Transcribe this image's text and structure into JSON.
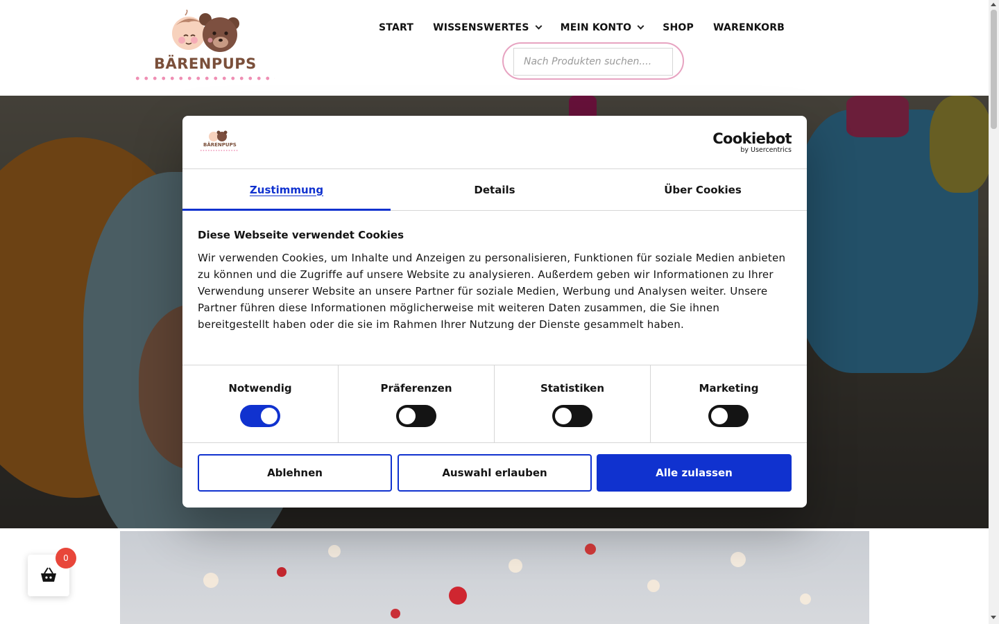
{
  "header": {
    "logo_text": "BÄRENPUPS",
    "nav": [
      {
        "label": "START",
        "has_dropdown": false
      },
      {
        "label": "WISSENSWERTES",
        "has_dropdown": true
      },
      {
        "label": "MEIN KONTO",
        "has_dropdown": true
      },
      {
        "label": "SHOP",
        "has_dropdown": false
      },
      {
        "label": "WARENKORB",
        "has_dropdown": false
      }
    ],
    "search": {
      "placeholder": "Nach Produkten suchen....",
      "value": ""
    }
  },
  "cookie_dialog": {
    "brand": {
      "name": "Cookiebot",
      "sub": "by Usercentrics"
    },
    "logo_text": "BÄRENPUPS",
    "tabs": [
      {
        "label": "Zustimmung",
        "active": true
      },
      {
        "label": "Details",
        "active": false
      },
      {
        "label": "Über Cookies",
        "active": false
      }
    ],
    "title": "Diese Webseite verwendet Cookies",
    "text": "Wir verwenden Cookies, um Inhalte und Anzeigen zu personalisieren, Funktionen für soziale Medien anbieten zu können und die Zugriffe auf unsere Website zu analysieren. Außerdem geben wir Informationen zu Ihrer Verwendung unserer Website an unsere Partner für soziale Medien, Werbung und Analysen weiter. Unsere Partner führen diese Informationen möglicherweise mit weiteren Daten zusammen, die Sie ihnen bereitgestellt haben oder die sie im Rahmen Ihrer Nutzung der Dienste gesammelt haben.",
    "toggles": [
      {
        "label": "Notwendig",
        "on": true
      },
      {
        "label": "Präferenzen",
        "on": false
      },
      {
        "label": "Statistiken",
        "on": false
      },
      {
        "label": "Marketing",
        "on": false
      }
    ],
    "buttons": {
      "decline": "Ablehnen",
      "allow_selection": "Auswahl erlauben",
      "allow_all": "Alle zulassen"
    }
  },
  "cart": {
    "count": "0"
  },
  "colors": {
    "accent_blue": "#1032cf",
    "badge_red": "#e8463a",
    "search_ring_pink": "#e7a3c1",
    "logo_brown": "#7a4f3a"
  }
}
